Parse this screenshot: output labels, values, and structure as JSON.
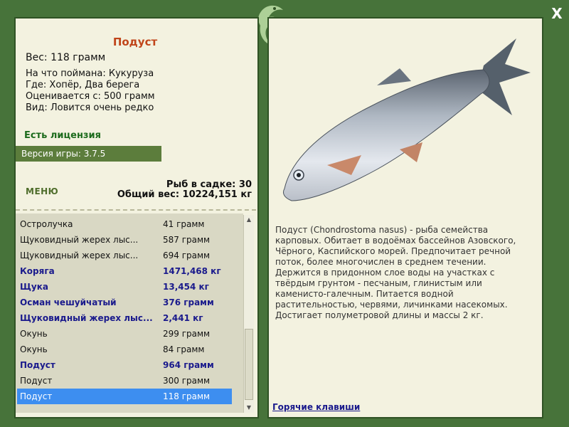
{
  "fish": {
    "name": "Подуст",
    "weight": "Вес: 118 грамм",
    "caught_on": "На что поймана: Кукуруза",
    "where": "Где: Хопёр, Два берега",
    "scored_from": "Оценивается с: 500 грамм",
    "kind": "Вид: Ловится очень редко"
  },
  "license": "Есть лицензия",
  "version": "Версия игры: 3.7.5",
  "menu_label": "МЕНЮ",
  "stats": {
    "fish_in_net": "Рыб в садке: 30",
    "total_weight": "Общий вес: 10224,151 кг"
  },
  "catch_list": [
    {
      "name": "Остролучка",
      "weight": "41 грамм",
      "bold": false,
      "selected": false
    },
    {
      "name": "Щуковидный жерех лыс...",
      "weight": "587 грамм",
      "bold": false,
      "selected": false
    },
    {
      "name": "Щуковидный жерех лыс...",
      "weight": "694 грамм",
      "bold": false,
      "selected": false
    },
    {
      "name": "Коряга",
      "weight": "1471,468 кг",
      "bold": true,
      "selected": false
    },
    {
      "name": "Щука",
      "weight": "13,454 кг",
      "bold": true,
      "selected": false
    },
    {
      "name": "Осман чешуйчатый",
      "weight": "376 грамм",
      "bold": true,
      "selected": false
    },
    {
      "name": "Щуковидный жерех лыс...",
      "weight": "2,441 кг",
      "bold": true,
      "selected": false
    },
    {
      "name": "Окунь",
      "weight": "299 грамм",
      "bold": false,
      "selected": false
    },
    {
      "name": "Окунь",
      "weight": "84 грамм",
      "bold": false,
      "selected": false
    },
    {
      "name": "Подуст",
      "weight": "964 грамм",
      "bold": true,
      "selected": false
    },
    {
      "name": "Подуст",
      "weight": "300 грамм",
      "bold": false,
      "selected": false
    },
    {
      "name": "Подуст",
      "weight": "118 грамм",
      "bold": false,
      "selected": true
    }
  ],
  "description": "Подуст (Chondrostoma nasus) - рыба семейства карповых. Обитает в водоёмах бассейнов Азовского, Чёрного, Каспийского морей. Предпочитает речной поток, более многочислен в среднем течении. Держится в придонном слое воды на участках с твёрдым грунтом - песчаным, глинистым или каменисто-галечным. Питается водной растительностью, червями, личинками насекомых. Достигает полуметровой длины и массы 2 кг.",
  "hotkeys_label": "Горячие клавиши",
  "close_label": "X",
  "icons": {
    "close": "close-icon",
    "logo": "fish-logo-icon",
    "scroll_up": "scroll-up-icon",
    "scroll_down": "scroll-down-icon"
  },
  "colors": {
    "frame": "#47733a",
    "panel": "#f3f2e0",
    "title": "#c0451a",
    "selection": "#3d8ef0",
    "bold_rows": "#1a1a8c",
    "license": "#1c6b1c"
  }
}
